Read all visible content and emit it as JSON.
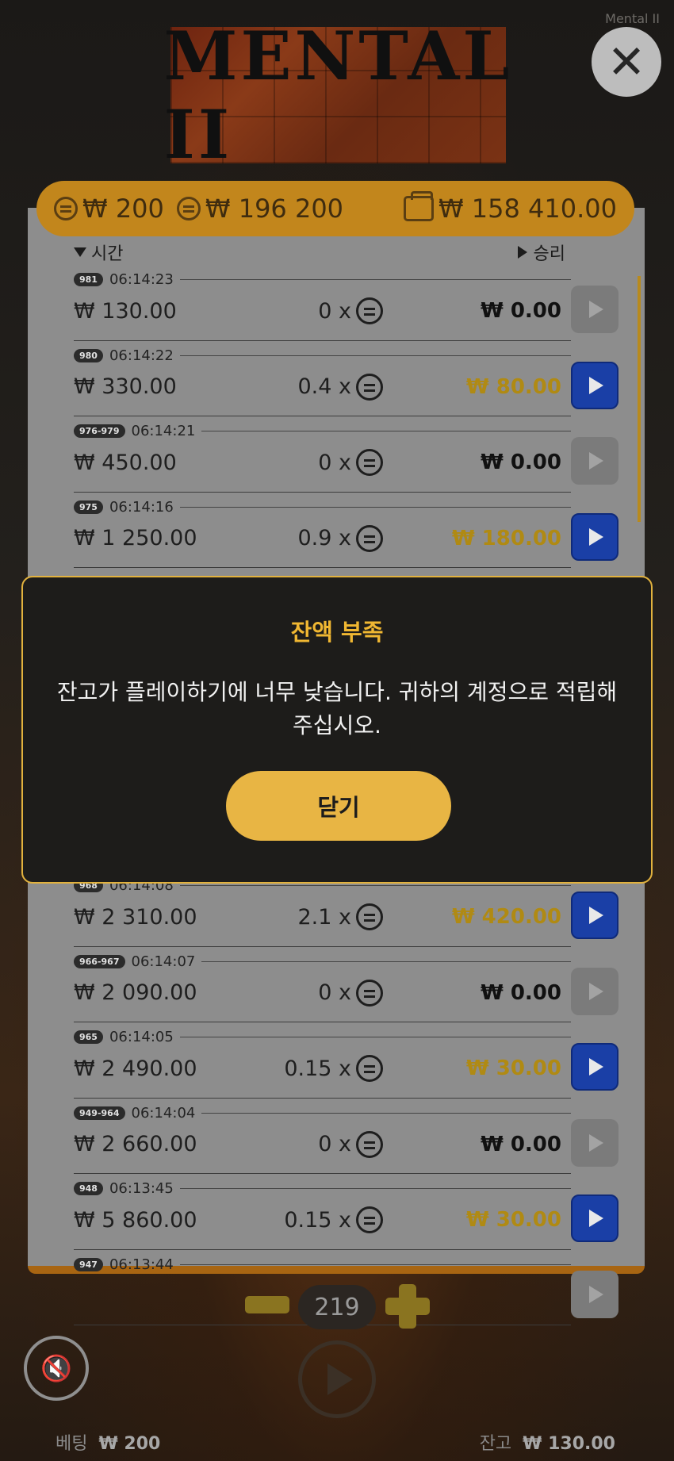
{
  "app": {
    "title": "Mental II",
    "logo_text": "MENTAL II"
  },
  "top_bar": {
    "bet": "₩ 200",
    "max_win": "₩ 196 200",
    "wallet": "₩ 158 410.00"
  },
  "history": {
    "header_time": "시간",
    "header_win": "승리",
    "rows": [
      {
        "badge": "981",
        "time": "06:14:23",
        "bet": "₩ 130.00",
        "multiplier": "0 x",
        "win": "₩ 0.00",
        "win_positive": false,
        "replay_enabled": false
      },
      {
        "badge": "980",
        "time": "06:14:22",
        "bet": "₩ 330.00",
        "multiplier": "0.4 x",
        "win": "₩ 80.00",
        "win_positive": true,
        "replay_enabled": true
      },
      {
        "badge": "976-979",
        "time": "06:14:21",
        "bet": "₩ 450.00",
        "multiplier": "0 x",
        "win": "₩ 0.00",
        "win_positive": false,
        "replay_enabled": false
      },
      {
        "badge": "975",
        "time": "06:14:16",
        "bet": "₩ 1 250.00",
        "multiplier": "0.9 x",
        "win": "₩ 180.00",
        "win_positive": true,
        "replay_enabled": true
      },
      {
        "badge": "",
        "time": "",
        "bet": "",
        "multiplier": "",
        "win": "",
        "win_positive": false,
        "replay_enabled": false
      },
      {
        "badge": "",
        "time": "",
        "bet": "",
        "multiplier": "",
        "win": "",
        "win_positive": false,
        "replay_enabled": true
      },
      {
        "badge": "",
        "time": "",
        "bet": "",
        "multiplier": "",
        "win": "",
        "win_positive": true,
        "replay_enabled": true
      },
      {
        "badge": "",
        "time": "",
        "bet": "",
        "multiplier": "",
        "win": "",
        "win_positive": false,
        "replay_enabled": false
      },
      {
        "badge": "968",
        "time": "06:14:08",
        "bet": "₩ 2 310.00",
        "multiplier": "2.1 x",
        "win": "₩ 420.00",
        "win_positive": true,
        "replay_enabled": true
      },
      {
        "badge": "966-967",
        "time": "06:14:07",
        "bet": "₩ 2 090.00",
        "multiplier": "0 x",
        "win": "₩ 0.00",
        "win_positive": false,
        "replay_enabled": false
      },
      {
        "badge": "965",
        "time": "06:14:05",
        "bet": "₩ 2 490.00",
        "multiplier": "0.15 x",
        "win": "₩ 30.00",
        "win_positive": true,
        "replay_enabled": true
      },
      {
        "badge": "949-964",
        "time": "06:14:04",
        "bet": "₩ 2 660.00",
        "multiplier": "0 x",
        "win": "₩ 0.00",
        "win_positive": false,
        "replay_enabled": false
      },
      {
        "badge": "948",
        "time": "06:13:45",
        "bet": "₩ 5 860.00",
        "multiplier": "0.15 x",
        "win": "₩ 30.00",
        "win_positive": true,
        "replay_enabled": true
      },
      {
        "badge": "947",
        "time": "06:13:44",
        "bet": "",
        "multiplier": "",
        "win": "",
        "win_positive": false,
        "replay_enabled": false
      }
    ]
  },
  "controls": {
    "count": "219"
  },
  "footer": {
    "bet_label": "베팅",
    "bet_value": "₩ 200",
    "balance_label": "잔고",
    "balance_value": "₩ 130.00"
  },
  "modal": {
    "title": "잔액 부족",
    "message": "잔고가 플레이하기에 너무 낮습니다. 귀하의 계정으로 적립해 주십시오.",
    "button": "닫기"
  },
  "colors": {
    "accent": "#e8b544",
    "win_positive": "#b08a13",
    "replay_active": "#1a3fa6",
    "stats_bar": "#c98a1c"
  }
}
